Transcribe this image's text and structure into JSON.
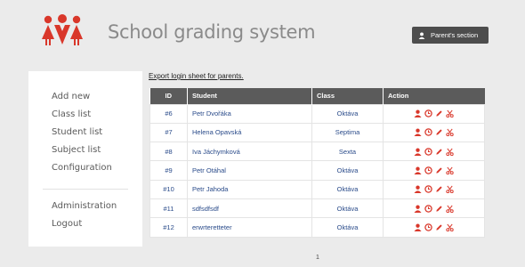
{
  "header": {
    "title": "School grading system",
    "parents_button": "Parent's section"
  },
  "sidebar": {
    "items": [
      {
        "label": "Add new",
        "name": "sidebar-item-add-new"
      },
      {
        "label": "Class list",
        "name": "sidebar-item-class-list"
      },
      {
        "label": "Student list",
        "name": "sidebar-item-student-list"
      },
      {
        "label": "Subject list",
        "name": "sidebar-item-subject-list"
      },
      {
        "label": "Configuration",
        "name": "sidebar-item-configuration"
      }
    ],
    "bottom_items": [
      {
        "label": "Administration",
        "name": "sidebar-item-administration"
      },
      {
        "label": "Logout",
        "name": "sidebar-item-logout"
      }
    ]
  },
  "main": {
    "export_link": "Export login sheet for parents.",
    "columns": [
      "ID",
      "Student",
      "Class",
      "Action"
    ],
    "rows": [
      {
        "id": "#6",
        "student": "Petr Dvořáka",
        "class": "Oktáva"
      },
      {
        "id": "#7",
        "student": "Helena Opavská",
        "class": "Septima"
      },
      {
        "id": "#8",
        "student": "Iva Jáchymková",
        "class": "Sexta"
      },
      {
        "id": "#9",
        "student": "Petr Otáhal",
        "class": "Oktáva"
      },
      {
        "id": "#10",
        "student": "Petr Jahoda",
        "class": "Oktáva"
      },
      {
        "id": "#11",
        "student": "sdfsdfsdf",
        "class": "Oktáva"
      },
      {
        "id": "#12",
        "student": "erwrteretteter",
        "class": "Oktáva"
      }
    ],
    "action_icons": [
      "user-icon",
      "clock-icon",
      "pencil-icon",
      "scissors-icon"
    ],
    "page": "1"
  },
  "colors": {
    "accent": "#d9372a",
    "header_bg": "#5b5b5b",
    "link": "#2a4b8a"
  }
}
